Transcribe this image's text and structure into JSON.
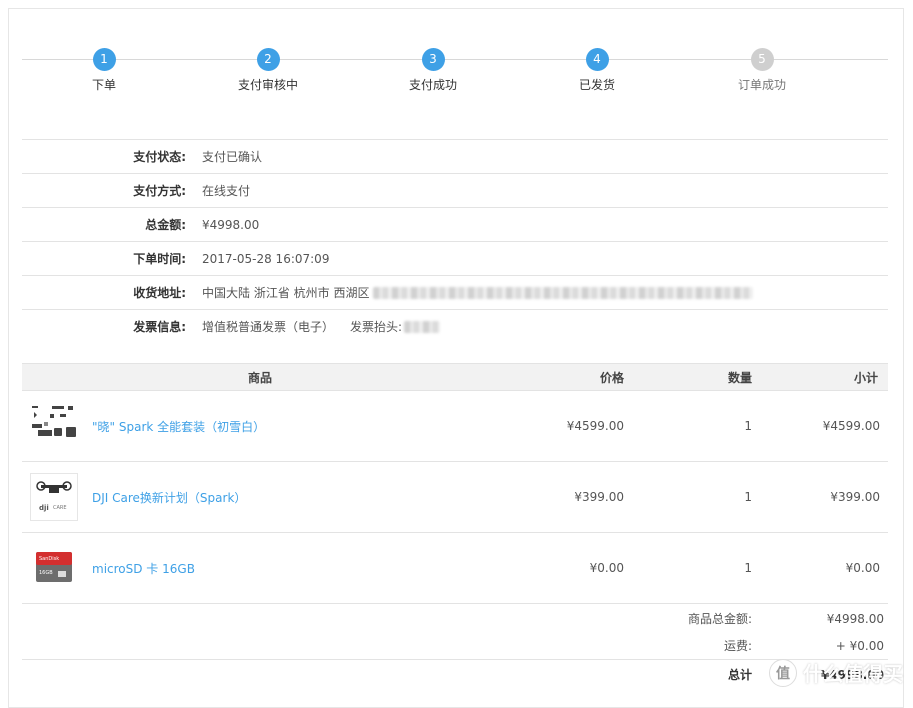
{
  "steps": [
    {
      "num": "1",
      "label": "下单",
      "state": "active"
    },
    {
      "num": "2",
      "label": "支付审核中",
      "state": "active"
    },
    {
      "num": "3",
      "label": "支付成功",
      "state": "active"
    },
    {
      "num": "4",
      "label": "已发货",
      "state": "active"
    },
    {
      "num": "5",
      "label": "订单成功",
      "state": "inactive"
    }
  ],
  "info": {
    "pay_status": {
      "key": "支付状态:",
      "value": "支付已确认"
    },
    "pay_method": {
      "key": "支付方式:",
      "value": "在线支付"
    },
    "total": {
      "key": "总金额:",
      "value": "¥4998.00"
    },
    "order_time": {
      "key": "下单时间:",
      "value": "2017-05-28 16:07:09"
    },
    "address": {
      "key": "收货地址:",
      "value": "中国大陆 浙江省 杭州市 西湖区"
    },
    "invoice": {
      "key": "发票信息:",
      "value": "增值税普通发票（电子）",
      "title_label": "发票抬头:"
    }
  },
  "table": {
    "headers": {
      "name": "商品",
      "price": "价格",
      "qty": "数量",
      "subtotal": "小计"
    },
    "rows": [
      {
        "name": "\"晓\" Spark 全能套装（初雪白）",
        "price": "¥4599.00",
        "qty": "1",
        "subtotal": "¥4599.00",
        "icon": "spark-kit-icon"
      },
      {
        "name": "DJI Care换新计划（Spark）",
        "price": "¥399.00",
        "qty": "1",
        "subtotal": "¥399.00",
        "icon": "dji-care-icon"
      },
      {
        "name": "microSD 卡 16GB",
        "price": "¥0.00",
        "qty": "1",
        "subtotal": "¥0.00",
        "icon": "sd-card-icon"
      }
    ]
  },
  "totals": {
    "goods_total": {
      "key": "商品总金额:",
      "value": "¥4998.00"
    },
    "shipping": {
      "key": "运费:",
      "value": "+ ¥0.00"
    },
    "final": {
      "key": "总计",
      "value": "¥4998.00"
    }
  },
  "watermark": {
    "text": "什么值得买"
  },
  "colors": {
    "accent": "#3ea0e6",
    "inactive": "#cfcfcf",
    "border": "#e3e3e3",
    "header_bg": "#f2f2f2"
  }
}
